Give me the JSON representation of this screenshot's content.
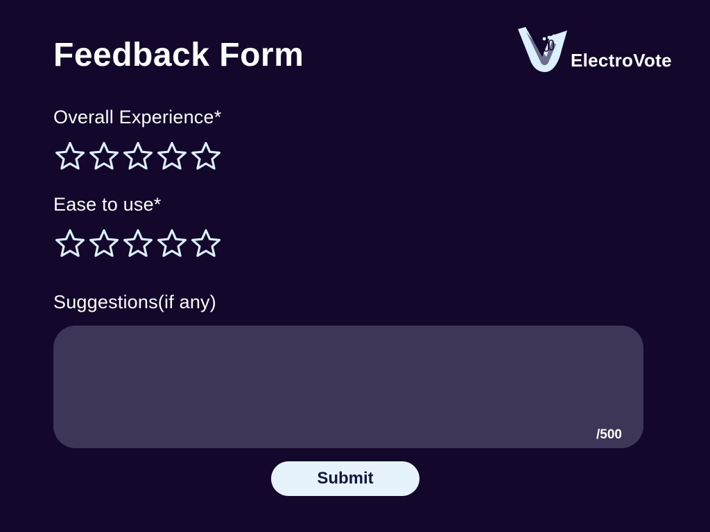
{
  "header": {
    "title": "Feedback Form",
    "brand_name": "ElectroVote",
    "logo_icon": "electrovote-hand-logo"
  },
  "form": {
    "overall_experience": {
      "label": "Overall Experience*",
      "rating": 0,
      "max_rating": 5,
      "star_icon": "star-outline-icon"
    },
    "ease_to_use": {
      "label": "Ease to use*",
      "rating": 0,
      "max_rating": 5,
      "star_icon": "star-outline-icon"
    },
    "suggestions": {
      "label": "Suggestions(if any)",
      "value": "",
      "char_count": "",
      "char_limit": "/500"
    },
    "submit_label": "Submit"
  },
  "colors": {
    "background": "#13082c",
    "text": "#ffffff",
    "star_outline": "#dcefff",
    "textarea_bg": "#3d3656",
    "button_bg": "#e6f3fd",
    "button_text": "#13163f"
  }
}
